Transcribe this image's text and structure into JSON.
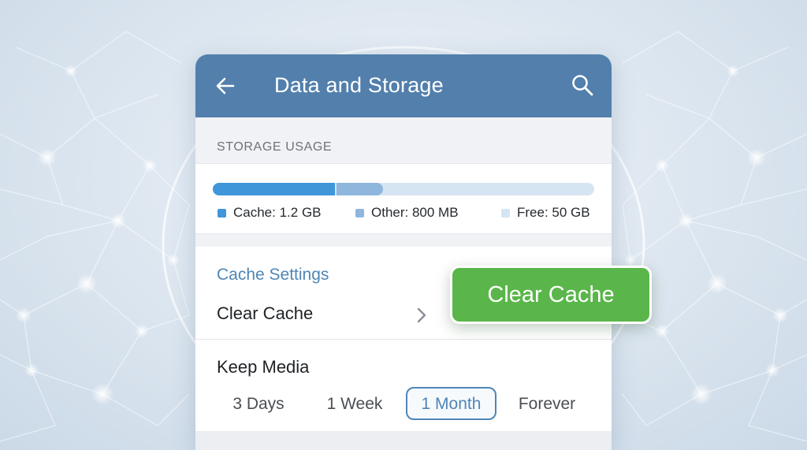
{
  "header": {
    "title": "Data and Storage",
    "back_icon": "arrow-left-icon",
    "search_icon": "search-icon"
  },
  "storage": {
    "section_label": "STORAGE USAGE",
    "usage_bar": {
      "cache_fraction": 0.32,
      "other_fraction": 0.125
    },
    "legend": [
      {
        "label": "Cache: 1.2 GB",
        "color": "#3f96d9"
      },
      {
        "label": "Other: 800 MB",
        "color": "#8fb6dc"
      },
      {
        "label": "Free: 50 GB",
        "color": "#d6e5f2"
      }
    ]
  },
  "cache_settings": {
    "heading": "Cache Settings",
    "clear_cache_row": "Clear Cache",
    "chevron_icon": "chevron-right-icon",
    "keep_media_label": "Keep Media",
    "keep_media_options": [
      "3 Days",
      "1 Week",
      "1 Month",
      "Forever"
    ],
    "keep_media_selected": "1 Month"
  },
  "action_button": {
    "label": "Clear Cache",
    "color": "#5ab64a"
  },
  "colors": {
    "header": "#527fac",
    "accent": "#4f86b6"
  }
}
